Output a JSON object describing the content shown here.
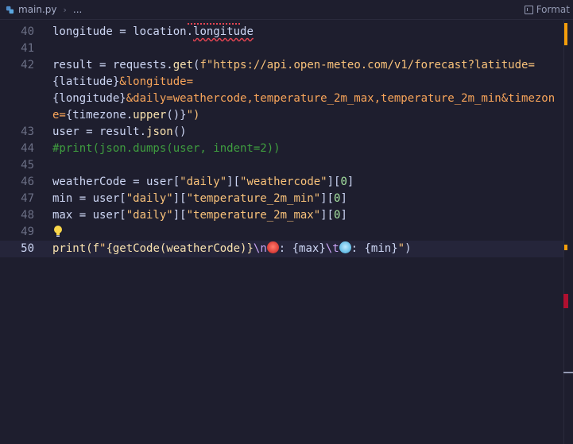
{
  "breadcrumb": {
    "file": "main.py",
    "more": "...",
    "format_label": "Format"
  },
  "lines": [
    {
      "no": "40"
    },
    {
      "no": "41"
    },
    {
      "no": "42"
    },
    {
      "no": "43"
    },
    {
      "no": "44"
    },
    {
      "no": "45"
    },
    {
      "no": "46"
    },
    {
      "no": "47"
    },
    {
      "no": "48"
    },
    {
      "no": "49"
    },
    {
      "no": "50"
    }
  ],
  "code": {
    "l40": {
      "a": "longitude = location.",
      "b": "longitude"
    },
    "l42": {
      "a": "result = requests.",
      "fn": "get",
      "p1": "(",
      "f": "f\"https://api.open-meteo.com/v1/forecast?latitude=",
      "w1a": "{latitude}",
      "w1b": "&longitude=",
      "w2a": "{longitude}",
      "w2b": "&daily=weathercode,temperature_2m_max,temperature_2m_min&timezon",
      "w3a": "e=",
      "w3b": "{timezone.",
      "w3fn": "upper",
      "w3c": "()}",
      "w3d": "\")"
    },
    "l43": {
      "a": "user = result.",
      "fn": "json",
      "b": "()"
    },
    "l44": {
      "cmt": "#print(json.dumps(user, indent=2))"
    },
    "l46": {
      "a": "weatherCode = user[",
      "s1": "\"daily\"",
      "b": "][",
      "s2": "\"weathercode\"",
      "c": "][",
      "n": "0",
      "d": "]"
    },
    "l47": {
      "a": "min = user[",
      "s1": "\"daily\"",
      "b": "][",
      "s2": "\"temperature_2m_min\"",
      "c": "][",
      "n": "0",
      "d": "]"
    },
    "l48": {
      "a": "max = user[",
      "s1": "\"daily\"",
      "b": "][",
      "s2": "\"temperature_2m_max\"",
      "c": "][",
      "n": "0",
      "d": "]"
    },
    "l50": {
      "a": "print(f",
      "q": "\"",
      "b": "{getCode(weatherCode)}",
      "e1": "\\n",
      "c": ": {max}",
      "e2": "\\t",
      "d": ": {min}",
      "q2": "\"",
      "end": ")"
    }
  },
  "colors": {
    "background": "#1e1e2e",
    "current_line": "#25253a",
    "string": "#f9c27a",
    "comment": "#3f9e3f",
    "number": "#a6e3a1",
    "escape": "#cba6f7",
    "scroll_warning": "#f59e0b",
    "scroll_error": "#b01030"
  },
  "icons": [
    "python-file-icon",
    "chevron-right-icon",
    "format-icon",
    "lightbulb-icon",
    "hot-face-emoji-icon",
    "cold-face-emoji-icon"
  ]
}
